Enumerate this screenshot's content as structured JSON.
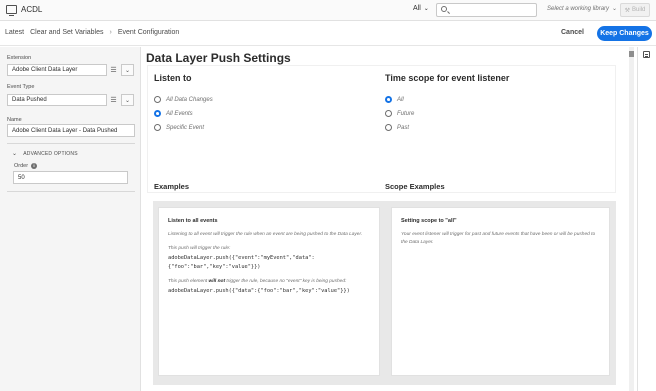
{
  "topbar": {
    "app_title": "ACDL",
    "environment": "All",
    "library_placeholder": "Select a working library",
    "build_label": "Build"
  },
  "breadcrumb": {
    "items": [
      "Latest",
      "Clear and Set Variables",
      "Event Configuration"
    ],
    "separator": "›"
  },
  "actions": {
    "cancel": "Cancel",
    "keep_changes": "Keep Changes"
  },
  "left_panel": {
    "extension_label": "Extension",
    "extension_value": "Adobe Client Data Layer",
    "event_type_label": "Event Type",
    "event_type_value": "Data Pushed",
    "name_label": "Name",
    "name_value": "Adobe Client Data Layer - Data Pushed",
    "advanced_label": "ADVANCED OPTIONS",
    "order_label": "Order",
    "order_value": "50"
  },
  "main": {
    "title": "Data Layer Push Settings",
    "listen_heading": "Listen to",
    "listen_options": [
      {
        "label": "All Data Changes",
        "checked": false
      },
      {
        "label": "All Events",
        "checked": true
      },
      {
        "label": "Specific Event",
        "checked": false
      }
    ],
    "scope_heading": "Time scope for event listener",
    "scope_options": [
      {
        "label": "All",
        "checked": true
      },
      {
        "label": "Future",
        "checked": false
      },
      {
        "label": "Past",
        "checked": false
      }
    ],
    "examples_heading": "Examples",
    "scope_examples_heading": "Scope Examples"
  },
  "example_card": {
    "title": "Listen to all events",
    "p1": "Listening to all event will trigger the rule when an event are being pushed to the Data Layer.",
    "p2": "This push will trigger the rule:",
    "code1a": "adobeDataLayer.push({\"event\":\"myEvent\",\"data\":",
    "code1b": "{\"foo\":\"bar\",\"key\":\"value\"}})",
    "p3_before": "This push element ",
    "p3_bold": "will not",
    "p3_after": " trigger the rule, because no \"event\" key is being pushed:",
    "code2": "adobeDataLayer.push({\"data\":{\"foo\":\"bar\",\"key\":\"value\"}})"
  },
  "scope_card": {
    "title": "Setting scope to \"all\"",
    "p1": "Your event listener will trigger for past and future events that have been or will be pushed to the Data Layer."
  },
  "colors": {
    "accent": "#1473e6",
    "panel_bg": "#f5f5f5",
    "examples_bg": "#e8e8e8"
  },
  "icons": {
    "app": "monitor-icon",
    "search": "search-icon",
    "build": "hammer-icon",
    "list": "list-icon",
    "chevron": "chevron-down-icon",
    "info": "info-icon",
    "rail": "comment-icon"
  }
}
